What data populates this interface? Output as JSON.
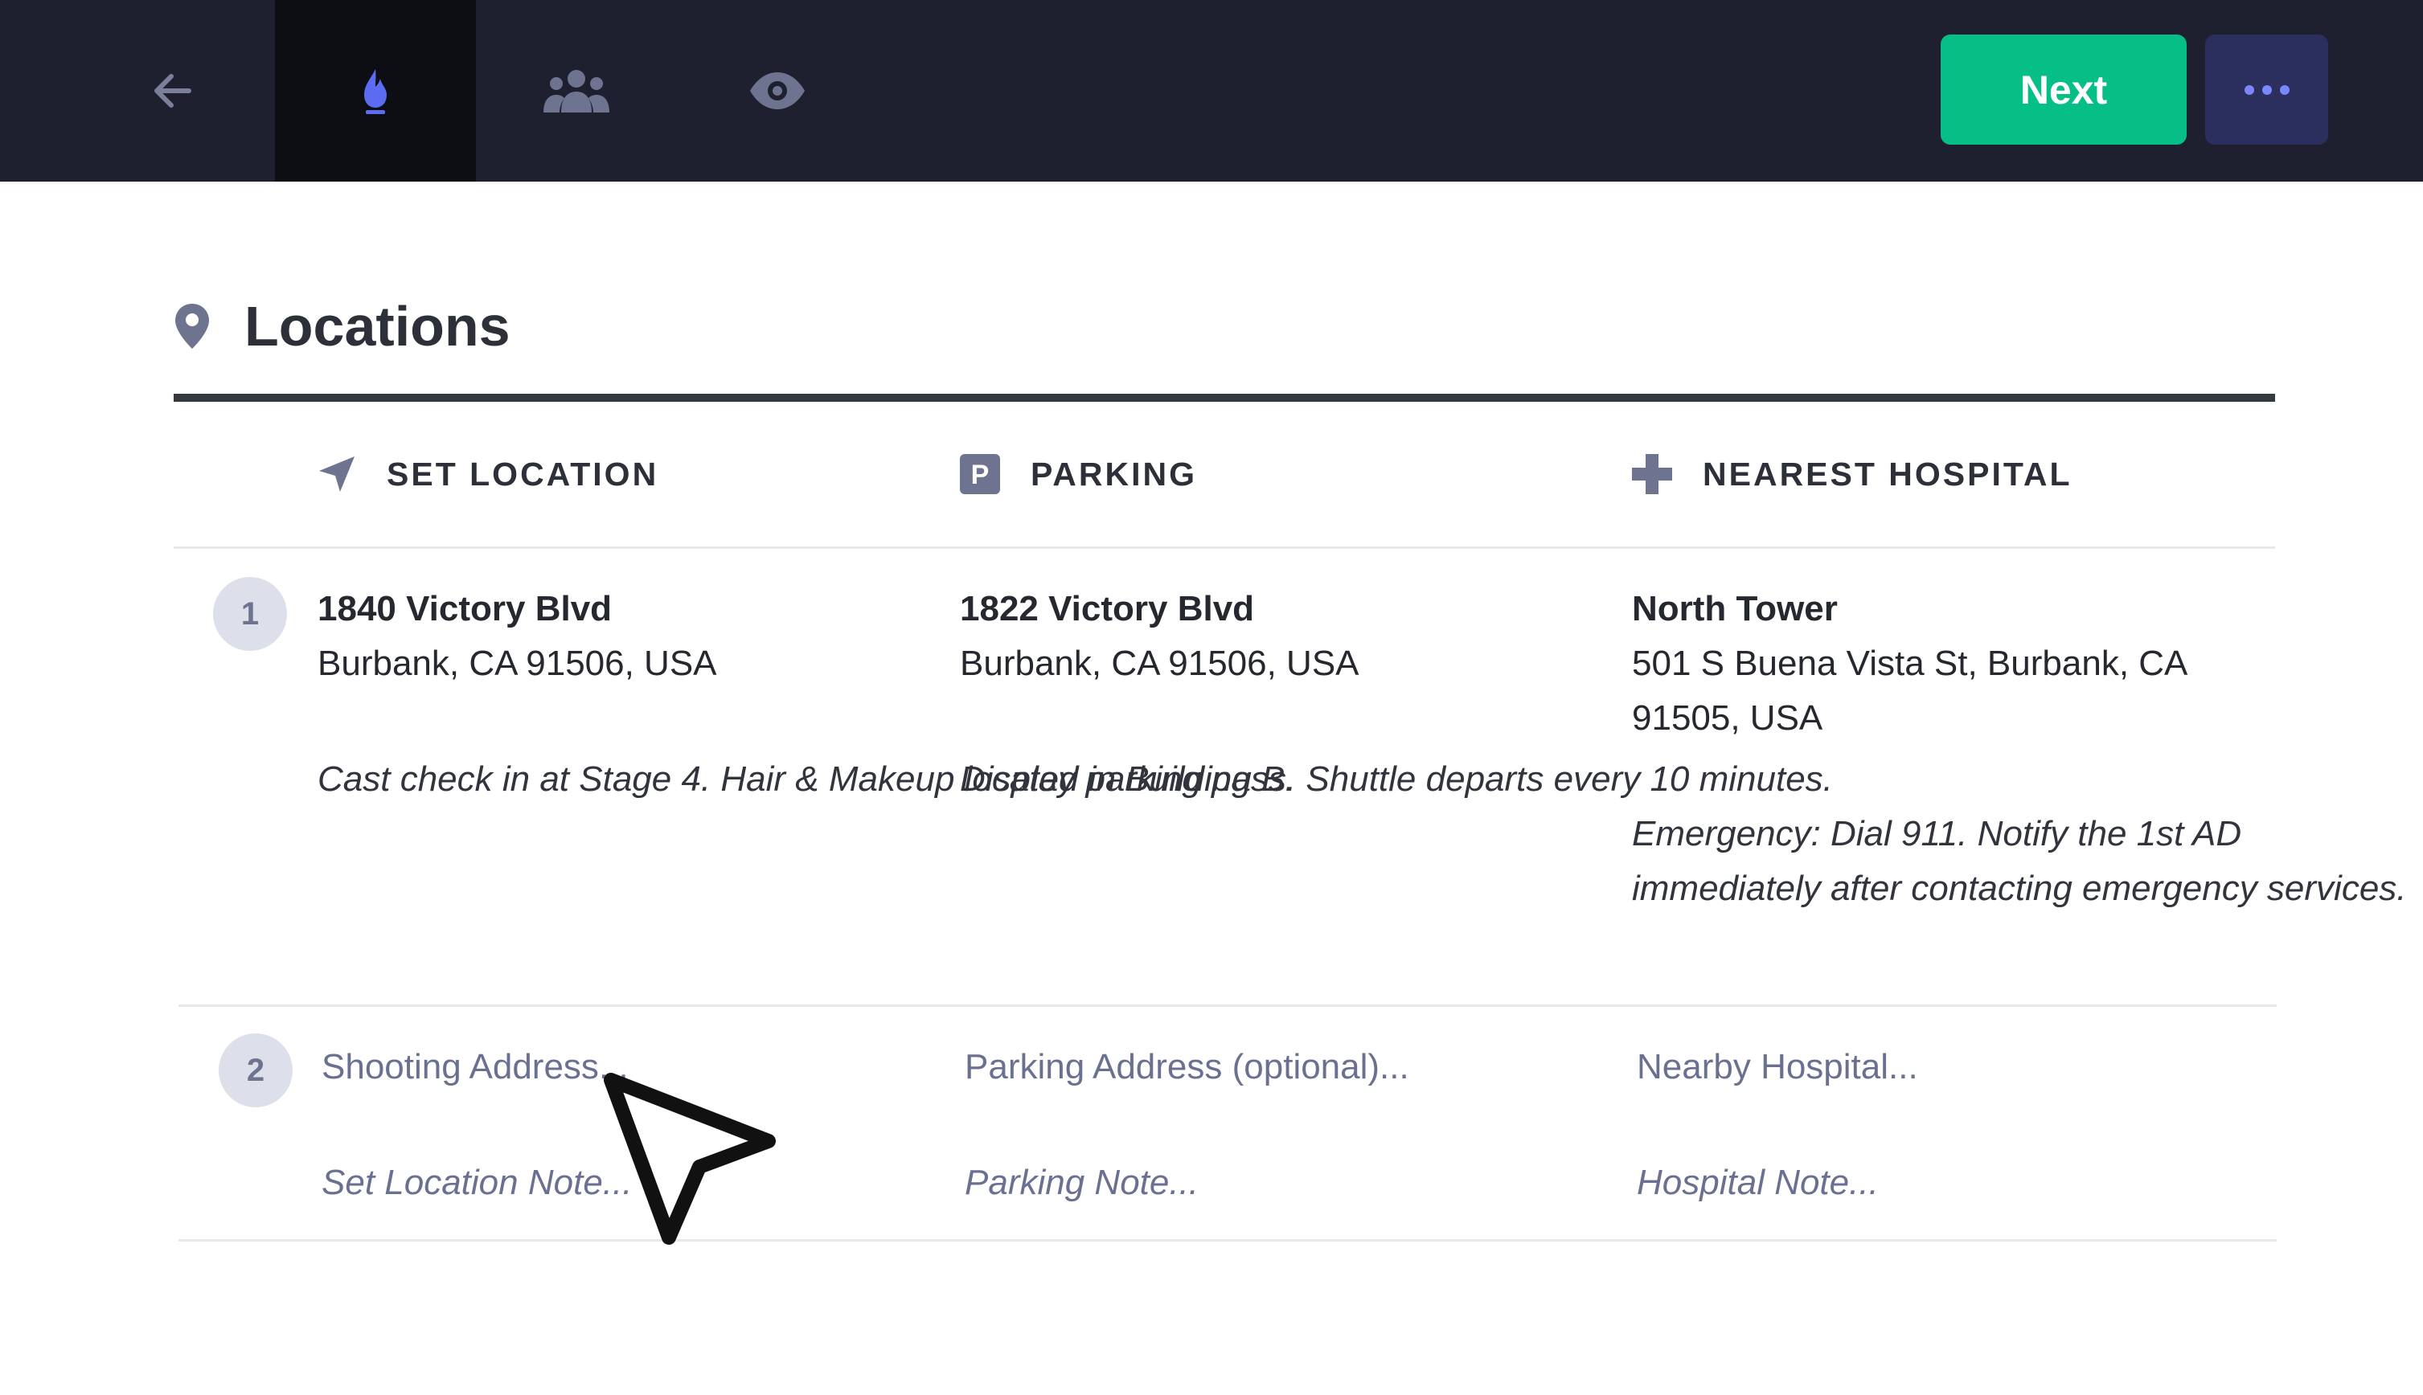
{
  "toolbar": {
    "back_icon": "arrow-left-icon",
    "tabs": [
      {
        "icon": "flame-icon",
        "active": true
      },
      {
        "icon": "people-icon",
        "active": false
      },
      {
        "icon": "eye-icon",
        "active": false
      }
    ],
    "next_label": "Next",
    "more_icon": "ellipsis-icon"
  },
  "section": {
    "icon": "map-pin-icon",
    "title": "Locations"
  },
  "columns": [
    {
      "icon": "navigation-arrow-icon",
      "label": "SET LOCATION"
    },
    {
      "icon": "parking-icon",
      "label": "PARKING"
    },
    {
      "icon": "medical-cross-icon",
      "label": "NEAREST HOSPITAL"
    }
  ],
  "rows": [
    {
      "number": "1",
      "set_location": {
        "name": "1840 Victory Blvd",
        "address": "Burbank, CA 91506, USA",
        "note_line1": "Cast check in at Stage 4. Hair &",
        "note_line2": "Makeup located in Building B."
      },
      "parking": {
        "name": "1822 Victory Blvd",
        "address": "Burbank, CA 91506, USA",
        "note_line1": "Display parking pass. Shuttle departs",
        "note_line2": "every 10 minutes."
      },
      "hospital": {
        "name": "North Tower",
        "address_line1": "501 S Buena Vista St, Burbank, CA",
        "address_line2": "91505, USA",
        "note_line1": "Emergency: Dial 911. Notify the 1st",
        "note_line2": "AD immediately after contacting",
        "note_line3": "emergency services."
      }
    }
  ],
  "new_row": {
    "number": "2",
    "set_location_placeholder": "Shooting Address...",
    "set_location_note_placeholder": "Set Location Note...",
    "parking_placeholder": "Parking Address (optional)...",
    "parking_note_placeholder": "Parking Note...",
    "hospital_placeholder": "Nearby Hospital...",
    "hospital_note_placeholder": "Hospital Note..."
  },
  "colors": {
    "topbar_bg": "#1e2030",
    "active_tab_bg": "#0d0d14",
    "accent_blue": "#5b6cf0",
    "next_green": "#06bf86",
    "more_btn_bg": "#2b2f5e",
    "icon_gray": "#6e7390"
  }
}
